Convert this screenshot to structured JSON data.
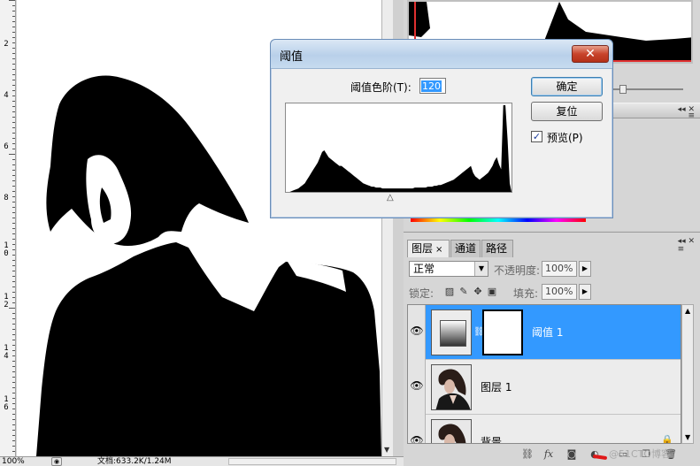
{
  "ruler": {
    "labels": [
      "2",
      "4",
      "6",
      "8",
      "1\n0",
      "1\n2",
      "1\n4",
      "1\n6"
    ]
  },
  "status_bar": {
    "zoom": "100%",
    "doc_info": "文档:633.2K/1.24M"
  },
  "threshold_dialog": {
    "title": "阈值",
    "close_glyph": "✕",
    "level_label": "阈值色阶(T):",
    "level_value": "120",
    "ok_label": "确定",
    "reset_label": "复位",
    "preview_label": "预览(P)",
    "preview_checked": true,
    "histogram_profile": [
      0,
      0,
      1,
      2,
      3,
      4,
      6,
      8,
      10,
      14,
      18,
      22,
      26,
      30,
      34,
      40,
      46,
      48,
      44,
      40,
      38,
      36,
      34,
      32,
      30,
      30,
      28,
      26,
      24,
      22,
      20,
      18,
      16,
      14,
      12,
      10,
      9,
      8,
      7,
      6,
      6,
      5,
      5,
      5,
      4,
      4,
      4,
      4,
      4,
      4,
      4,
      4,
      4,
      4,
      4,
      4,
      4,
      4,
      4,
      5,
      5,
      5,
      5,
      5,
      5,
      6,
      6,
      6,
      7,
      7,
      8,
      8,
      9,
      10,
      11,
      12,
      13,
      14,
      16,
      18,
      20,
      22,
      24,
      26,
      28,
      30,
      22,
      18,
      16,
      14,
      16,
      18,
      20,
      22,
      26,
      30,
      36,
      40,
      32,
      26,
      100,
      100,
      60,
      10
    ]
  },
  "layers_panel": {
    "tabs": [
      {
        "label": "图层",
        "active": true,
        "close": "×"
      },
      {
        "label": "通道",
        "active": false
      },
      {
        "label": "路径",
        "active": false
      }
    ],
    "blend_mode": "正常",
    "opacity_label": "不透明度:",
    "opacity_value": "100%",
    "lock_label": "锁定:",
    "fill_label": "填充:",
    "fill_value": "100%",
    "layers": [
      {
        "name": "阈值 1",
        "selected": true,
        "type": "adjustment"
      },
      {
        "name": "图层 1",
        "selected": false,
        "type": "pixel"
      },
      {
        "name": "背景",
        "selected": false,
        "type": "pixel"
      }
    ],
    "watermark": "@51CTO博客",
    "toolbar_icons": [
      "link-icon",
      "fx-icon",
      "mask-icon",
      "adjustment-icon",
      "folder-icon",
      "new-layer-icon",
      "trash-icon"
    ]
  },
  "colors": {
    "selection_blue": "#3399ff",
    "close_red": "#c8442c",
    "titlebar_blue": "#c6dbef"
  }
}
